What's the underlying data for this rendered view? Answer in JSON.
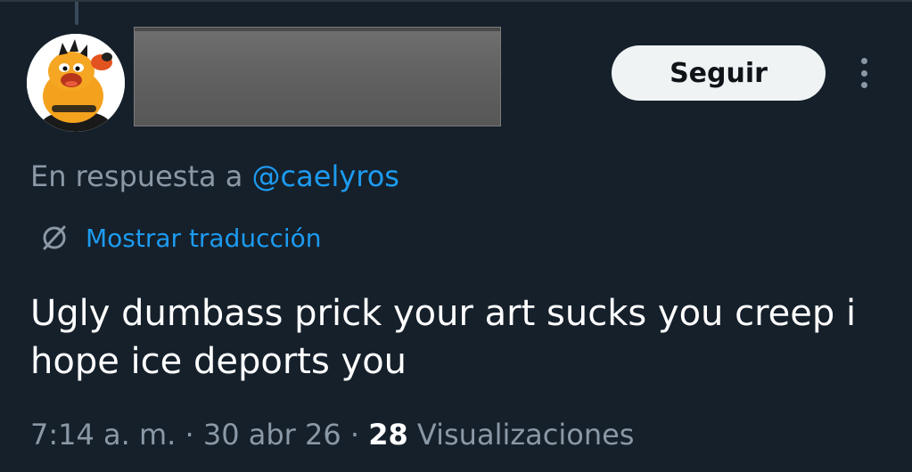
{
  "author": {
    "avatar_alt": "profile picture",
    "display_name_redacted": true
  },
  "header": {
    "follow_label": "Seguir",
    "more_icon": "three-dots-vertical-icon"
  },
  "reply": {
    "prefix": "En respuesta a",
    "mention": "@caelyros"
  },
  "translation": {
    "icon": "globe-icon",
    "label": "Mostrar traducción"
  },
  "tweet": {
    "text": "Ugly dumbass prick your art sucks you creep i hope ice deports you"
  },
  "meta": {
    "time": "7:14 a. m.",
    "separator": "·",
    "date": "30 abr 26",
    "views_count": "28",
    "views_label": "Visualizaciones"
  },
  "colors": {
    "background": "#15202b",
    "link": "#1d9bf0",
    "muted": "#8b98a5",
    "button_bg": "#eff3f4"
  }
}
